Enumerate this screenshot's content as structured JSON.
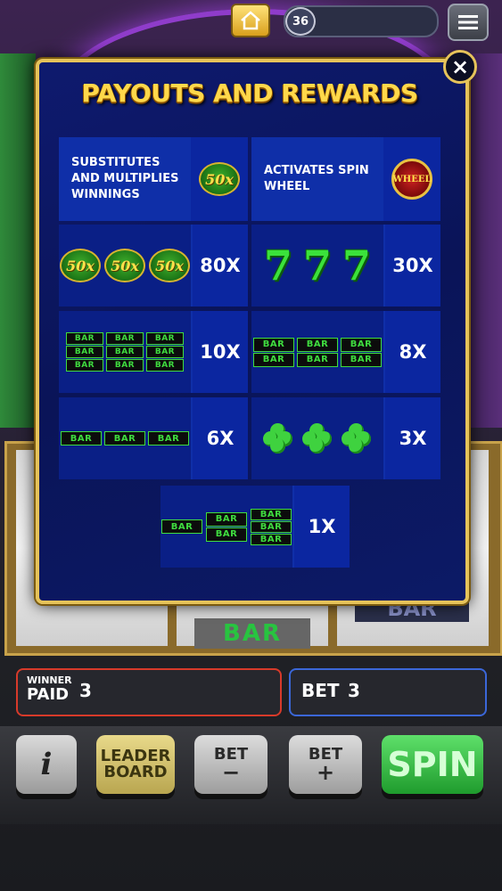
{
  "top_bar": {
    "level": "36"
  },
  "modal": {
    "title": "PAYOUTS AND REWARDS",
    "close": "×",
    "special": [
      {
        "desc": "SUBSTITUTES AND MULTIPLIES WINNINGS",
        "symbol": "50x"
      },
      {
        "desc": "ACTIVATES SPIN WHEEL",
        "symbol": "WHEEL"
      }
    ],
    "payouts": [
      {
        "symbol": "50x",
        "multiplier": "80X"
      },
      {
        "symbol": "7",
        "multiplier": "30X"
      },
      {
        "symbol": "BAR",
        "multiplier": "10X"
      },
      {
        "symbol": "BAR",
        "multiplier": "8X"
      },
      {
        "symbol": "BAR",
        "multiplier": "6X"
      },
      {
        "symbol": "clover",
        "multiplier": "3X"
      },
      {
        "symbol": "BAR",
        "multiplier": "1X"
      }
    ]
  },
  "reels": {
    "visible_symbol_1": "BAR",
    "visible_symbol_2": "BAR"
  },
  "status": {
    "winner_paid_label_1": "WINNER",
    "winner_paid_label_2": "PAID",
    "winner_paid_value": "3",
    "bet_label": "BET",
    "bet_value": "3"
  },
  "buttons": {
    "info": "i",
    "leaderboard_1": "LEADER",
    "leaderboard_2": "BOARD",
    "bet_minus_label": "BET",
    "bet_minus_sign": "−",
    "bet_plus_label": "BET",
    "bet_plus_sign": "+",
    "spin": "SPIN"
  },
  "colors": {
    "modal_bg": "#0a1458",
    "title": "#ffd84a",
    "spin_green": "#1f9b2d",
    "bet_border": "#3b67d8",
    "paid_border": "#d73a2a"
  }
}
